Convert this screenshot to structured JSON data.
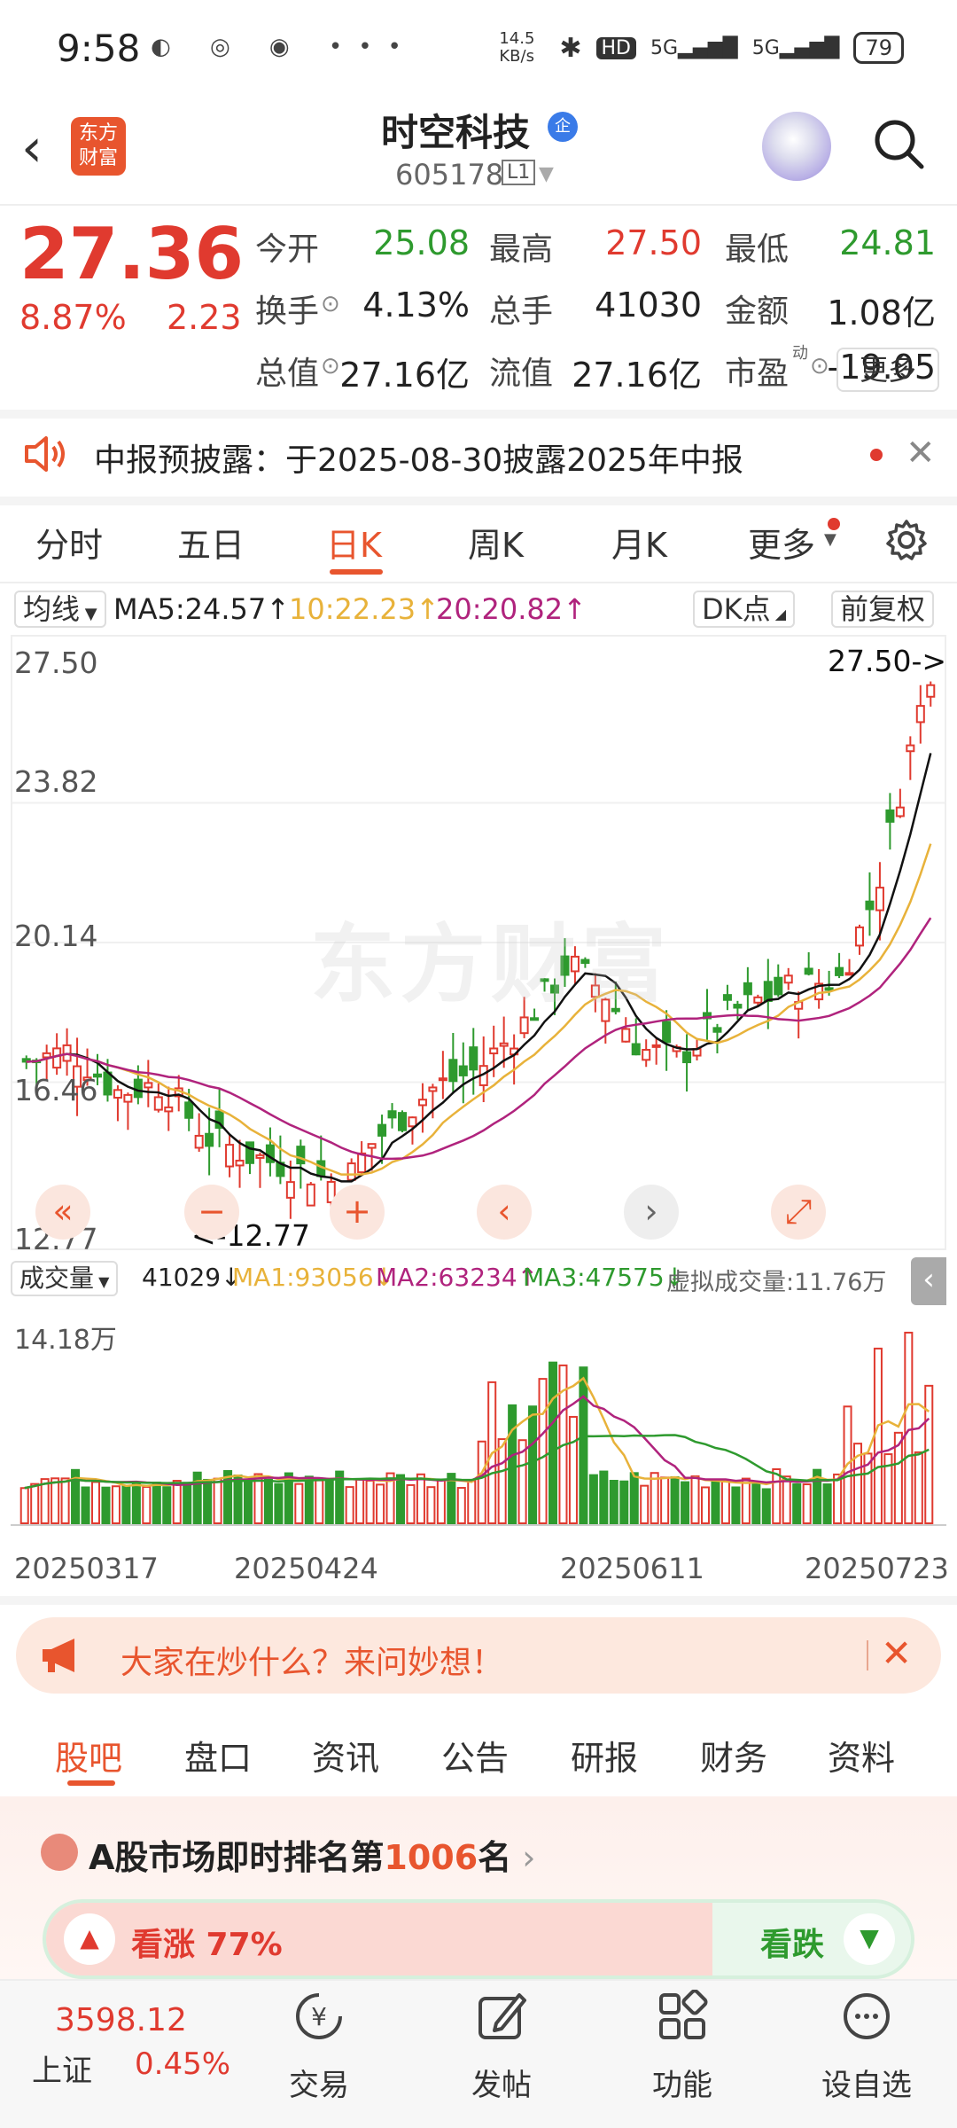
{
  "status_bar": {
    "time": "9:58",
    "net_speed": "14.5 KB/s",
    "battery": "79"
  },
  "header": {
    "logo": "东方财富",
    "stock_name": "时空科技",
    "badge": "企",
    "stock_code": "605178",
    "level": "L1"
  },
  "quote": {
    "price": "27.36",
    "change_pct": "8.87%",
    "change_amt": "2.23",
    "fields": [
      {
        "label": "今开",
        "value": "25.08",
        "color": "#2e9a2e"
      },
      {
        "label": "最高",
        "value": "27.50",
        "color": "#e03a2f"
      },
      {
        "label": "最低",
        "value": "24.81",
        "color": "#2e9a2e"
      },
      {
        "label": "换手",
        "value": "4.13%",
        "color": "#222222"
      },
      {
        "label": "总手",
        "value": "41030",
        "color": "#222222"
      },
      {
        "label": "金额",
        "value": "1.08亿",
        "color": "#222222"
      },
      {
        "label": "总值",
        "value": "27.16亿",
        "color": "#222222"
      },
      {
        "label": "流值",
        "value": "27.16亿",
        "color": "#222222"
      },
      {
        "label": "市盈",
        "value": "-19.05",
        "color": "#222222"
      }
    ],
    "pe_superscript": "动",
    "more_button": "更多"
  },
  "notice": {
    "text": "中报预披露：于2025-08-30披露2025年中报"
  },
  "chart_tabs": [
    "分时",
    "五日",
    "日K",
    "周K",
    "月K",
    "更多"
  ],
  "active_tab": "日K",
  "chart_controls": {
    "indicator": "均线",
    "ma5": "MA5:24.57↑",
    "ma10": "10:22.23↑",
    "ma20": "20:20.82↑",
    "dk_button": "DK点",
    "adjust_button": "前复权"
  },
  "chart_data": [
    {
      "type": "candlestick",
      "title": "",
      "y_ticks": [
        "27.50",
        "23.82",
        "20.14",
        "16.46",
        "12.77"
      ],
      "ylim": [
        12.77,
        27.5
      ],
      "max_label": "27.50->",
      "min_label": "<-12.77",
      "x_ticks": [
        "20250317",
        "20250424",
        "20250611",
        "20250723"
      ],
      "series": [
        {
          "name": "MA5",
          "color": "#111111"
        },
        {
          "name": "MA10",
          "color": "#e8b23a"
        },
        {
          "name": "MA20",
          "color": "#b0237d"
        }
      ],
      "last_close": 27.36,
      "grid": true
    },
    {
      "type": "bar",
      "title": "",
      "y_max_label": "14.18万",
      "ylim": [
        0,
        14.18
      ],
      "series": [
        {
          "name": "MA1",
          "color": "#e8b23a"
        },
        {
          "name": "MA2",
          "color": "#b0237d"
        },
        {
          "name": "MA3",
          "color": "#2e9a2e"
        }
      ]
    }
  ],
  "volume_controls": {
    "indicator": "成交量",
    "vol": "41029↓",
    "ma1": "MA1:93056↓",
    "ma2": "MA2:63234↑",
    "ma3": "MA3:47575↓",
    "virtual": "虚拟成交量:11.76万"
  },
  "banner": {
    "text": "大家在炒什么？来问妙想！"
  },
  "bottom_tabs": [
    "股吧",
    "盘口",
    "资讯",
    "公告",
    "研报",
    "财务",
    "资料"
  ],
  "rank": {
    "prefix": "A股市场即时排名第",
    "number": "1006",
    "suffix": "名"
  },
  "vote": {
    "up": "看涨 77%",
    "up_fraction": 0.77,
    "down": "看跌"
  },
  "index": {
    "value": "3598.12",
    "name": "上证",
    "change": "0.45%"
  },
  "bottom_nav": [
    "交易",
    "发帖",
    "功能",
    "设自选"
  ]
}
